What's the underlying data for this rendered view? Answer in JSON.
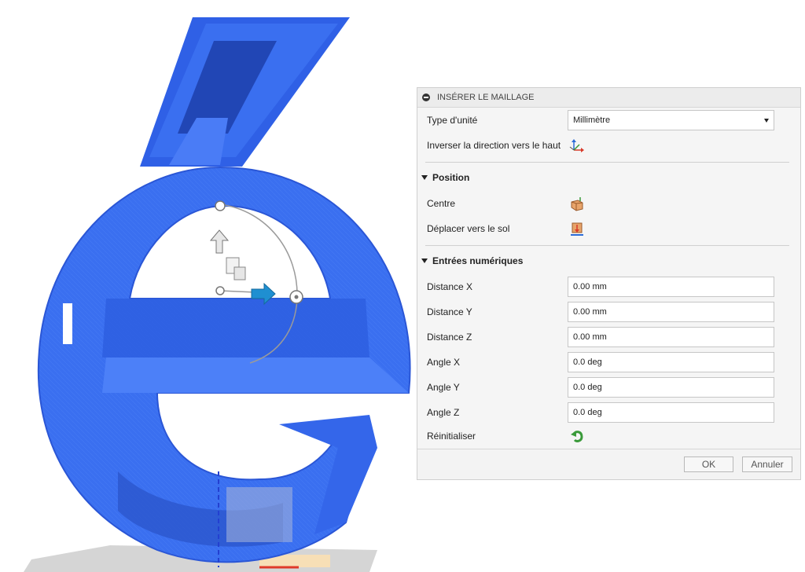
{
  "panel": {
    "title": "INSÉRER LE MAILLAGE",
    "unit_type": {
      "label": "Type d'unité",
      "value": "Millimètre"
    },
    "flip_up": {
      "label": "Inverser la direction vers le haut",
      "icon": "axis-flip-icon"
    },
    "position_section": {
      "label": "Position"
    },
    "centre": {
      "label": "Centre",
      "icon": "center-icon"
    },
    "ground": {
      "label": "Déplacer vers le sol",
      "icon": "move-to-ground-icon"
    },
    "numeric_section": {
      "label": "Entrées numériques"
    },
    "fields": [
      {
        "label": "Distance X",
        "value": "0.00 mm"
      },
      {
        "label": "Distance Y",
        "value": "0.00 mm"
      },
      {
        "label": "Distance Z",
        "value": "0.00 mm"
      },
      {
        "label": "Angle X",
        "value": "0.0 deg"
      },
      {
        "label": "Angle Y",
        "value": "0.0 deg"
      },
      {
        "label": "Angle Z",
        "value": "0.0 deg"
      }
    ],
    "reset": {
      "label": "Réinitialiser",
      "icon": "reset-icon"
    },
    "ok_label": "OK",
    "cancel_label": "Annuler"
  },
  "colors": {
    "mesh_blue": "#3a6ff0",
    "mesh_dark": "#2b55cc",
    "mesh_light": "#5a8cff",
    "gizmo_blue": "#1f8fd1",
    "reset_green": "#3a9a3a"
  }
}
